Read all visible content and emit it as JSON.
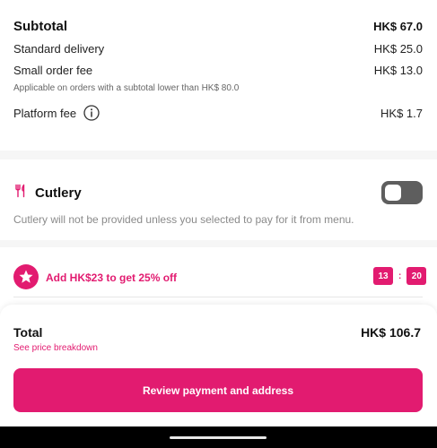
{
  "summary": {
    "subtotal_label": "Subtotal",
    "subtotal_value": "HK$ 67.0",
    "delivery_label": "Standard delivery",
    "delivery_value": "HK$ 25.0",
    "small_order_label": "Small order fee",
    "small_order_value": "HK$ 13.0",
    "small_order_note": "Applicable on orders with a subtotal lower than HK$ 80.0",
    "platform_label": "Platform fee",
    "platform_value": "HK$ 1.7",
    "info_icon": "info-icon"
  },
  "cutlery": {
    "icon": "cutlery-icon",
    "title": "Cutlery",
    "description": "Cutlery will not be provided unless you selected to pay for it from menu.",
    "toggle_on": false
  },
  "promo": {
    "icon": "star-icon",
    "text": "Add HK$23 to get 25% off",
    "timer_minutes": "13",
    "timer_separator": ":",
    "timer_seconds": "20"
  },
  "footer": {
    "total_label": "Total",
    "total_value": "HK$ 106.7",
    "breakdown_link": "See price breakdown",
    "button_label": "Review payment and address"
  },
  "colors": {
    "accent": "#e21b70",
    "toggle_off": "#5e5e5e",
    "muted_text": "#8a8a8a"
  }
}
